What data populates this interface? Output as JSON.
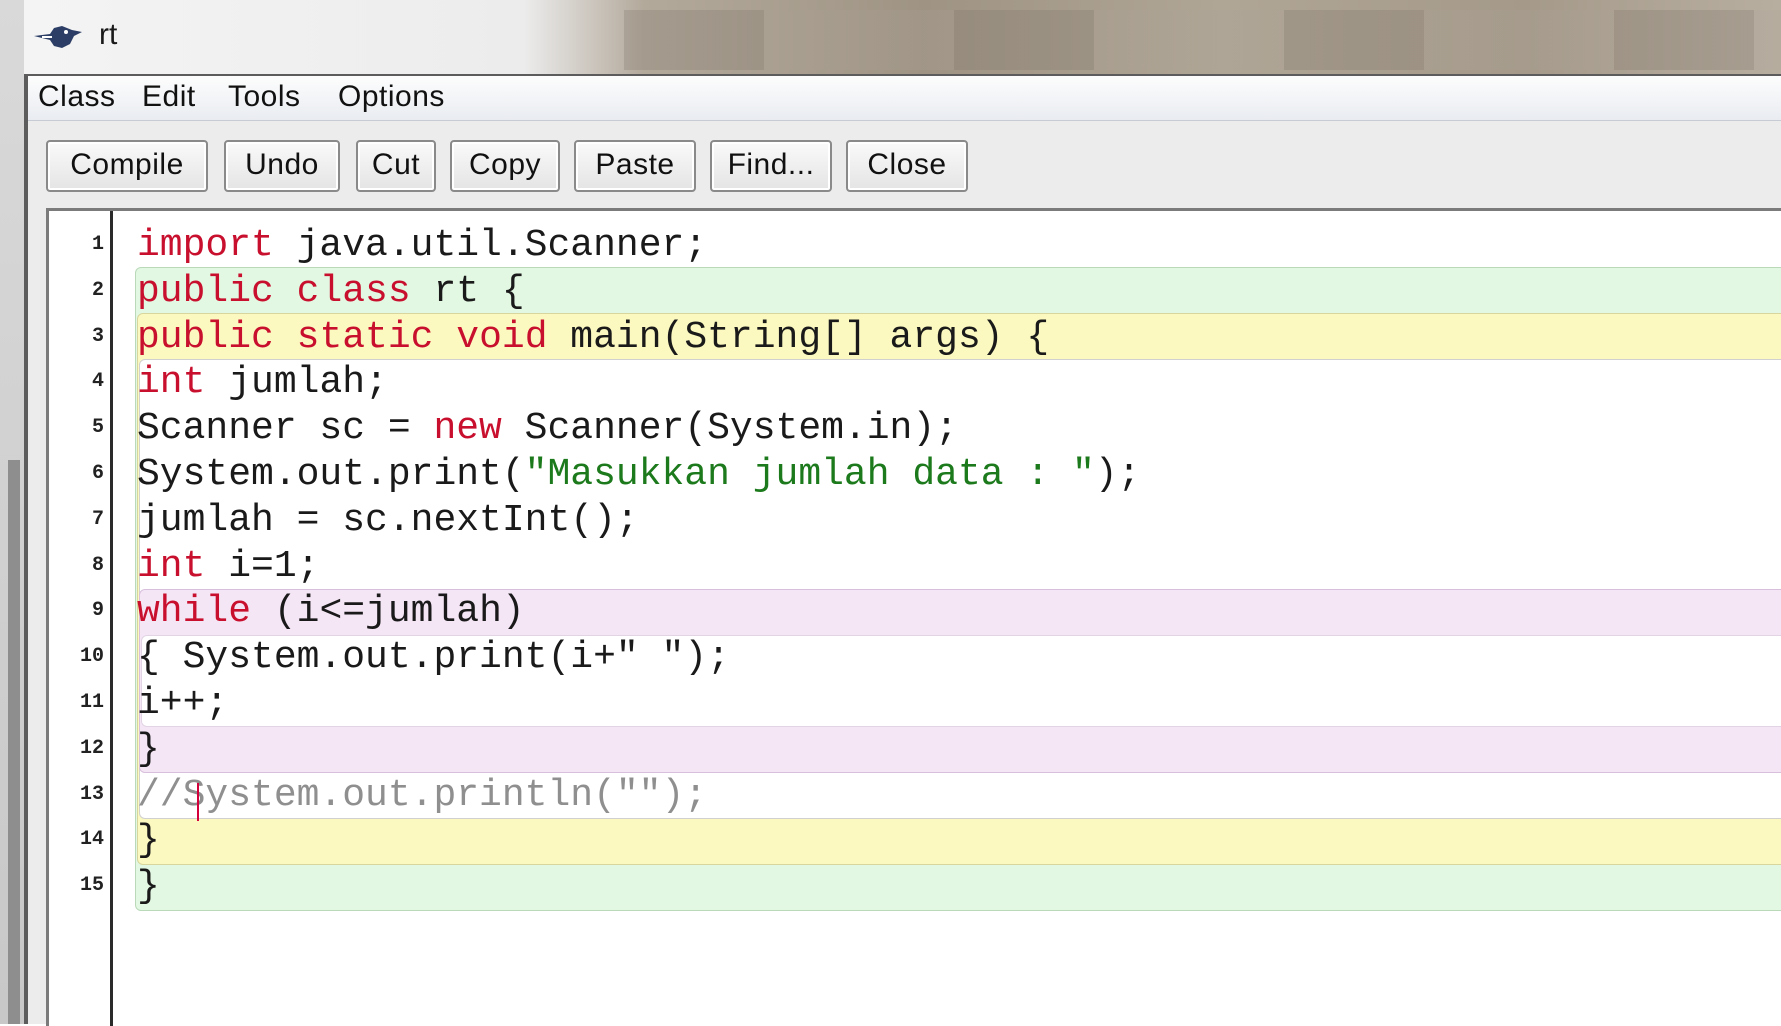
{
  "window": {
    "title": "rt"
  },
  "menu": {
    "items": [
      "Class",
      "Edit",
      "Tools",
      "Options"
    ]
  },
  "toolbar": {
    "buttons": [
      "Compile",
      "Undo",
      "Cut",
      "Copy",
      "Paste",
      "Find...",
      "Close"
    ]
  },
  "editor": {
    "line_numbers": [
      "1",
      "2",
      "3",
      "4",
      "5",
      "6",
      "7",
      "8",
      "9",
      "10",
      "11",
      "12",
      "13",
      "14",
      "15"
    ],
    "lines": [
      {
        "segments": [
          [
            "kw",
            "import"
          ],
          [
            "p",
            " java.util.Scanner;"
          ]
        ]
      },
      {
        "segments": [
          [
            "kw",
            "public"
          ],
          [
            "p",
            " "
          ],
          [
            "kw",
            "class"
          ],
          [
            "p",
            " rt {"
          ]
        ]
      },
      {
        "segments": [
          [
            "kw",
            "public"
          ],
          [
            "p",
            " "
          ],
          [
            "kw",
            "static"
          ],
          [
            "p",
            " "
          ],
          [
            "kw",
            "void"
          ],
          [
            "p",
            " main(String[] args) {"
          ]
        ]
      },
      {
        "segments": [
          [
            "kw",
            "int"
          ],
          [
            "p",
            " jumlah;"
          ]
        ]
      },
      {
        "segments": [
          [
            "p",
            "Scanner sc = "
          ],
          [
            "kw",
            "new"
          ],
          [
            "p",
            " Scanner(System.in);"
          ]
        ]
      },
      {
        "segments": [
          [
            "p",
            "System.out.print("
          ],
          [
            "str",
            "\"Masukkan jumlah data : \""
          ],
          [
            "p",
            ");"
          ]
        ]
      },
      {
        "segments": [
          [
            "p",
            "jumlah = sc.nextInt();"
          ]
        ]
      },
      {
        "segments": [
          [
            "kw",
            "int"
          ],
          [
            "p",
            " i=1;"
          ]
        ]
      },
      {
        "segments": [
          [
            "kw",
            "while"
          ],
          [
            "p",
            " (i<=jumlah)"
          ]
        ]
      },
      {
        "segments": [
          [
            "p",
            "{ System.out.print(i+\" \");"
          ]
        ]
      },
      {
        "segments": [
          [
            "p",
            "i++;"
          ]
        ]
      },
      {
        "segments": [
          [
            "p",
            "}"
          ]
        ]
      },
      {
        "segments": [
          [
            "cmt",
            "//System.out.println(\"\");"
          ]
        ]
      },
      {
        "segments": [
          [
            "p",
            "}"
          ]
        ]
      },
      {
        "segments": [
          [
            "p",
            "}"
          ]
        ]
      }
    ],
    "scope_colors": {
      "class": "#e2f8e2",
      "method": "#fbf9c0",
      "loop": "#f5e6f6"
    }
  },
  "colors": {
    "keyword": "#c8102e",
    "string": "#1c7a1c",
    "comment": "#8f8f8f",
    "caret": "#d4003c"
  }
}
